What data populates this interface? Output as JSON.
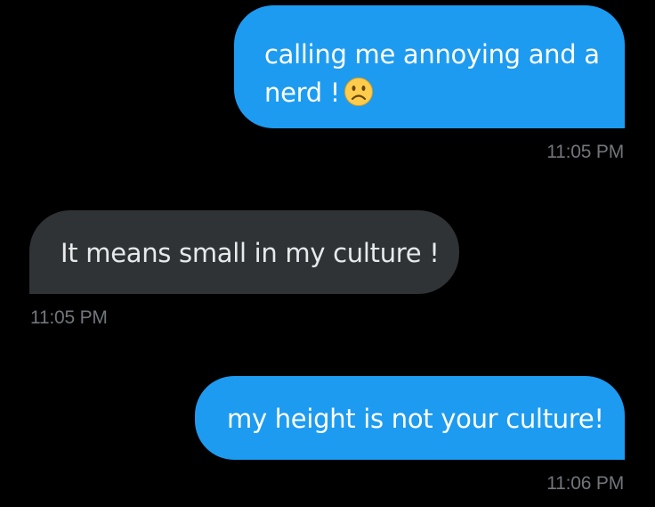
{
  "messages": [
    {
      "direction": "sent",
      "text": "calling me annoying and a nerd !",
      "emoji": "slightly-frowning-face",
      "time": "11:05 PM"
    },
    {
      "direction": "received",
      "text": "It means small in my culture !",
      "time": "11:05 PM"
    },
    {
      "direction": "sent",
      "text": "my height is not your culture!",
      "time": "11:06 PM"
    }
  ],
  "colors": {
    "background": "#000000",
    "sent_bubble": "#1d9bf0",
    "received_bubble": "#2f3336",
    "timestamp": "#71767b"
  }
}
